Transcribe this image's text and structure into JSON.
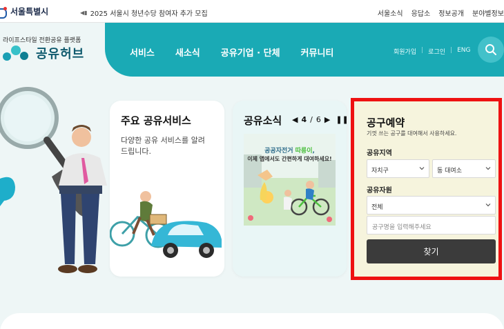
{
  "topbar": {
    "city_name": "서울특별시",
    "notice": "2025 서울시 청년수당 참여자 추가 모집",
    "links": [
      "서울소식",
      "응답소",
      "정보공개",
      "분야별정보"
    ]
  },
  "brand": {
    "tagline": "라이프스타일 전환공유 플랫폼",
    "name": "공유허브"
  },
  "nav": {
    "items": [
      "서비스",
      "새소식",
      "공유기업 · 단체",
      "커뮤니티"
    ],
    "aux": [
      "회원가입",
      "로그인",
      "ENG"
    ]
  },
  "main_card": {
    "title": "주요 공유서비스",
    "description": "다양한 공유 서비스를 알려드립니다."
  },
  "news_card": {
    "title": "공유소식",
    "page_current": "4",
    "page_sep": "/",
    "page_total": "6",
    "thumb_line1_a": "공공자전거 ",
    "thumb_line1_b": "따릉이",
    "thumb_line1_c": ",",
    "thumb_line2": "이제 앱에서도 간편하게 대여하세요!"
  },
  "booking": {
    "title": "공구예약",
    "description": "기껏 쓰는 공구를 대여해서 사용하세요.",
    "region_label": "공유지역",
    "district_value": "자치구",
    "office_value": "동 대여소",
    "resource_label": "공유자원",
    "resource_value": "전체",
    "tool_placeholder": "공구명을 입력해주세요",
    "submit_label": "찾기"
  },
  "colors": {
    "teal": "#1aaab5",
    "highlight_border": "#ee1111",
    "booking_bg": "#f6f4dd",
    "button_dark": "#3b3b3b"
  }
}
